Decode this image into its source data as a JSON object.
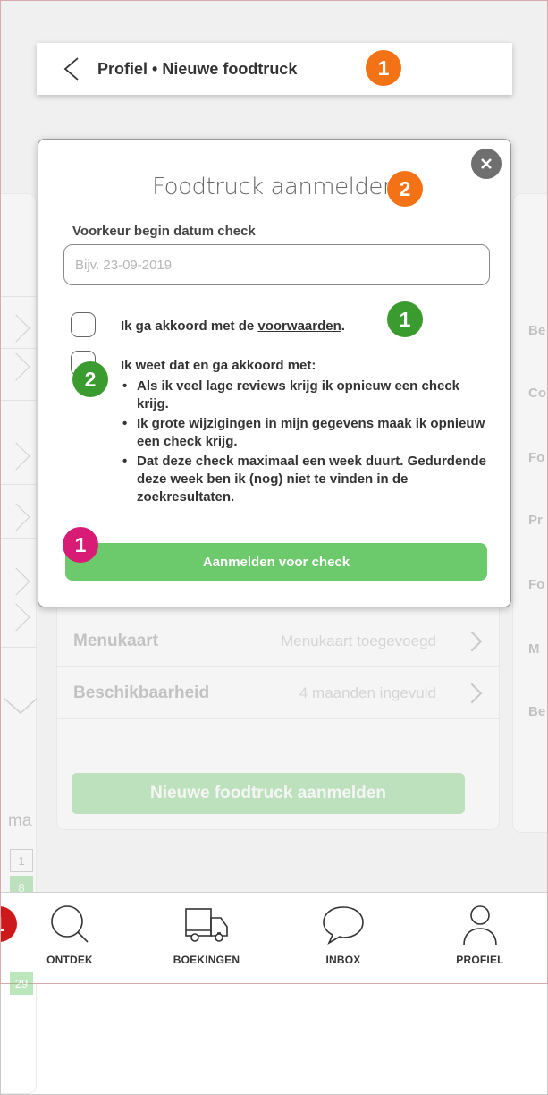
{
  "header": {
    "title": "Profiel • Nieuwe foodtruck",
    "badge": "1"
  },
  "modal": {
    "title": "Foodtruck aanmelden",
    "title_badge": "2",
    "date_label": "Voorkeur begin datum check",
    "date_placeholder": "Bijv. 23-09-2019",
    "checkbox1_text_prefix": "Ik ga akkoord met de ",
    "checkbox1_link": "voorwaarden",
    "checkbox1_text_suffix": ".",
    "checkbox1_badge": "1",
    "checkbox2_text": "Ik weet dat en ga akkoord met:",
    "checkbox2_badge": "2",
    "bullets": [
      "Als ik veel lage reviews krijg ik opnieuw een check krijg.",
      "Ik grote wijzigingen in mijn gegevens maak ik opnieuw een check krijg.",
      "Dat deze check maximaal een week duurt. Gedurdende deze week ben ik (nog) niet te vinden in de zoekresultaten."
    ],
    "submit_label": "Aanmelden voor check",
    "submit_badge": "1"
  },
  "background": {
    "rows": [
      {
        "label": "Menukaart",
        "value": "Menukaart toegevoegd"
      },
      {
        "label": "Beschikbaarheid",
        "value": "4 maanden ingevuld"
      }
    ],
    "new_button": "Nieuwe foodtruck aanmelden",
    "right_labels": [
      "Be",
      "Co",
      "Fo",
      "Pr",
      "Fo",
      "M",
      "Be"
    ],
    "left_text": "ma",
    "cal_days": [
      "1",
      "8",
      "29"
    ]
  },
  "nav_badge": "1",
  "bottom_nav": [
    {
      "label": "ONTDEK",
      "icon": "search-icon"
    },
    {
      "label": "BOEKINGEN",
      "icon": "truck-icon"
    },
    {
      "label": "INBOX",
      "icon": "chat-bubble-icon"
    },
    {
      "label": "PROFIEL",
      "icon": "user-icon"
    }
  ],
  "colors": {
    "accent_green": "#6cc96c",
    "badge_orange": "#f47216",
    "badge_green": "#3a9b2f",
    "badge_pink": "#d81b74"
  }
}
